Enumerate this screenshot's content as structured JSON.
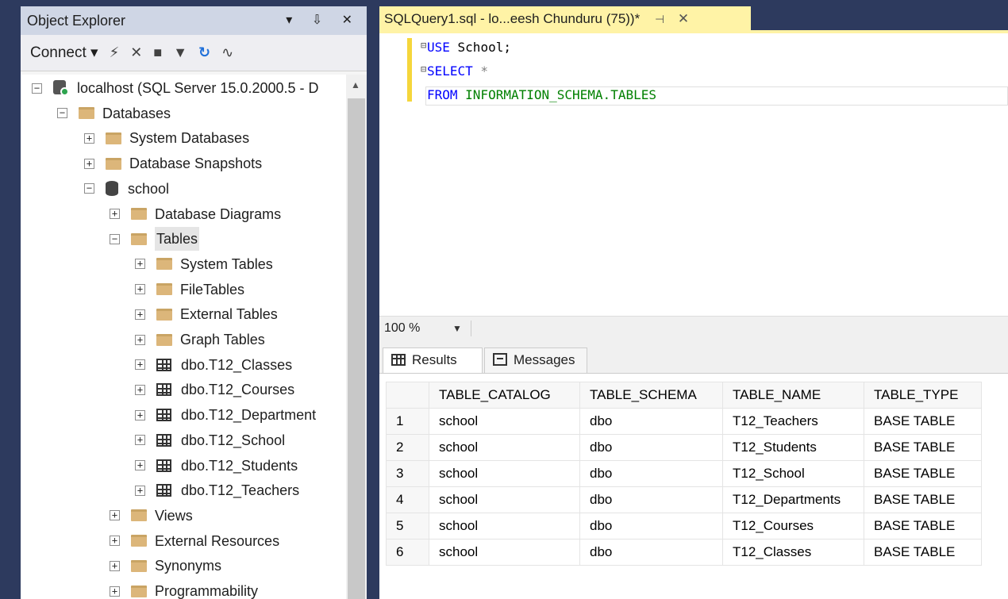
{
  "object_explorer": {
    "title": "Object Explorer",
    "title_controls": "▾ ⇩ ✕",
    "toolbar": {
      "connect_label": "Connect"
    },
    "tree": [
      {
        "label": "localhost (SQL Server 15.0.2000.5 - D",
        "icon": "server-icon",
        "expander": "−",
        "level": 0
      },
      {
        "label": "Databases",
        "icon": "folder-icon",
        "expander": "−",
        "level": 1
      },
      {
        "label": "System Databases",
        "icon": "folder-icon",
        "expander": "+",
        "level": 2
      },
      {
        "label": "Database Snapshots",
        "icon": "folder-icon",
        "expander": "+",
        "level": 2
      },
      {
        "label": "school",
        "icon": "database-icon",
        "expander": "−",
        "level": 2
      },
      {
        "label": "Database Diagrams",
        "icon": "folder-icon",
        "expander": "+",
        "level": 3
      },
      {
        "label": "Tables",
        "icon": "folder-icon",
        "expander": "−",
        "level": 3,
        "selected": true
      },
      {
        "label": "System Tables",
        "icon": "folder-icon",
        "expander": "+",
        "level": 4
      },
      {
        "label": "FileTables",
        "icon": "folder-icon",
        "expander": "+",
        "level": 4
      },
      {
        "label": "External Tables",
        "icon": "folder-icon",
        "expander": "+",
        "level": 4
      },
      {
        "label": "Graph Tables",
        "icon": "folder-icon",
        "expander": "+",
        "level": 4
      },
      {
        "label": "dbo.T12_Classes",
        "icon": "table-icon",
        "expander": "+",
        "level": 4
      },
      {
        "label": "dbo.T12_Courses",
        "icon": "table-icon",
        "expander": "+",
        "level": 4
      },
      {
        "label": "dbo.T12_Department",
        "icon": "table-icon",
        "expander": "+",
        "level": 4
      },
      {
        "label": "dbo.T12_School",
        "icon": "table-icon",
        "expander": "+",
        "level": 4
      },
      {
        "label": "dbo.T12_Students",
        "icon": "table-icon",
        "expander": "+",
        "level": 4
      },
      {
        "label": "dbo.T12_Teachers",
        "icon": "table-icon",
        "expander": "+",
        "level": 4
      },
      {
        "label": "Views",
        "icon": "folder-icon",
        "expander": "+",
        "level": 3
      },
      {
        "label": "External Resources",
        "icon": "folder-icon",
        "expander": "+",
        "level": 3
      },
      {
        "label": "Synonyms",
        "icon": "folder-icon",
        "expander": "+",
        "level": 3
      },
      {
        "label": "Programmability",
        "icon": "folder-icon",
        "expander": "+",
        "level": 3
      }
    ]
  },
  "editor": {
    "tab_title": "SQLQuery1.sql - lo...eesh Chunduru (75))*",
    "code": {
      "line1_kw": "USE",
      "line1_rest": " School;",
      "line2_kw": "SELECT",
      "line2_rest": " *",
      "line3_kw": "FROM",
      "line3_rest": " INFORMATION_SCHEMA.TABLES"
    },
    "zoom": "100 %"
  },
  "results": {
    "tabs": {
      "results": "Results",
      "messages": "Messages"
    },
    "columns": [
      "TABLE_CATALOG",
      "TABLE_SCHEMA",
      "TABLE_NAME",
      "TABLE_TYPE"
    ],
    "rows": [
      [
        "1",
        "school",
        "dbo",
        "T12_Teachers",
        "BASE TABLE"
      ],
      [
        "2",
        "school",
        "dbo",
        "T12_Students",
        "BASE TABLE"
      ],
      [
        "3",
        "school",
        "dbo",
        "T12_School",
        "BASE TABLE"
      ],
      [
        "4",
        "school",
        "dbo",
        "T12_Departments",
        "BASE TABLE"
      ],
      [
        "5",
        "school",
        "dbo",
        "T12_Courses",
        "BASE TABLE"
      ],
      [
        "6",
        "school",
        "dbo",
        "T12_Classes",
        "BASE TABLE"
      ]
    ]
  },
  "colors": {
    "chrome": "#2d3a5e",
    "active_tab": "#fff3a6",
    "keyword": "#0000ff",
    "system_object": "#008000",
    "folder": "#dcb67a"
  }
}
